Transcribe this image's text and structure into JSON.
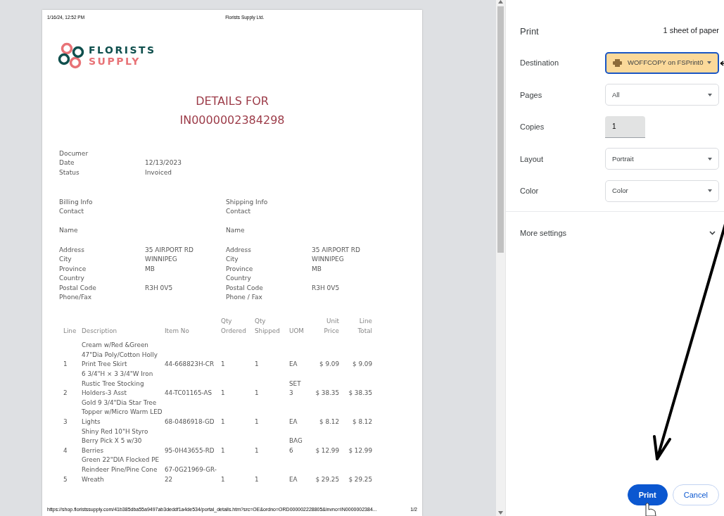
{
  "preview": {
    "header_left": "1/16/24, 12:52 PM",
    "header_center": "Florists Supply Ltd.",
    "logo": {
      "line1": "FLORISTS",
      "line2": "SUPPLY"
    },
    "title_lines": [
      "DETAILS FOR",
      "IN0000002384298"
    ],
    "doc_info": [
      {
        "label": "Documer"
      },
      {
        "label": "Date",
        "value": "12/13/2023"
      },
      {
        "label": "Status",
        "value": "Invoiced"
      }
    ],
    "addresses": [
      {
        "heading": "Billing Info",
        "groups": [
          [
            {
              "label": "Contact"
            }
          ],
          [
            {
              "label": "Name"
            }
          ],
          [
            {
              "label": "Address",
              "value": "35 AIRPORT RD"
            },
            {
              "label": "City",
              "value": "WINNIPEG"
            },
            {
              "label": "Province",
              "value": "MB"
            },
            {
              "label": "Country"
            },
            {
              "label": "Postal Code",
              "value": "R3H 0V5"
            },
            {
              "label": "Phone/Fax"
            }
          ]
        ]
      },
      {
        "heading": "Shipping Info",
        "groups": [
          [
            {
              "label": "Contact"
            }
          ],
          [
            {
              "label": "Name"
            }
          ],
          [
            {
              "label": "Address",
              "value": "35 AIRPORT RD"
            },
            {
              "label": "City",
              "value": "WINNIPEG"
            },
            {
              "label": "Province",
              "value": "MB"
            },
            {
              "label": "Country"
            },
            {
              "label": "Postal Code",
              "value": "R3H 0V5"
            },
            {
              "label": "Phone / Fax"
            }
          ]
        ]
      }
    ],
    "table": {
      "columns": [
        {
          "lines": [
            "Line"
          ]
        },
        {
          "lines": [
            "Description"
          ]
        },
        {
          "lines": [
            "Item No"
          ]
        },
        {
          "lines": [
            "Qty",
            "Ordered"
          ]
        },
        {
          "lines": [
            "Qty",
            "Shipped"
          ]
        },
        {
          "lines": [
            "UOM"
          ]
        },
        {
          "lines": [
            "Unit",
            "Price"
          ]
        },
        {
          "lines": [
            "Line",
            "Total"
          ]
        }
      ],
      "rows": [
        [
          "1",
          "Cream w/Red &Green 47\"Dia Poly/Cotton Holly Print Tree Skirt",
          "44-668823H-CR",
          "1",
          "1",
          "EA",
          "$ 9.09",
          "$ 9.09"
        ],
        [
          "2",
          "6 3/4\"H × 3 3/4\"W Iron Rustic Tree Stocking Holders-3 Asst",
          "44-TC01165-AS",
          "1",
          "1",
          "SET 3",
          "$ 38.35",
          "$ 38.35"
        ],
        [
          "3",
          "Gold 9 3/4\"Dia Star Tree Topper w/Micro Warm LED Lights",
          "68-0486918-GD",
          "1",
          "1",
          "EA",
          "$ 8.12",
          "$ 8.12"
        ],
        [
          "4",
          "Shiny Red 10\"H Styro Berry Pick X 5 w/30 Berries",
          "95-0H43655-RD",
          "1",
          "1",
          "BAG 6",
          "$ 12.99",
          "$ 12.99"
        ],
        [
          "5",
          "Green 22\"DIA Flocked PE Reindeer Pine/Pine Cone Wreath",
          "67-0G21969-GR-22",
          "1",
          "1",
          "EA",
          "$ 29.25",
          "$ 29.25"
        ]
      ]
    },
    "footer_url": "https://shop.floristssupply.com/41b385dba55a9497ab3deddf1a4de534/portal_details.htm?src=OE&ordno=ORD000002228805&invno=IN0000002384...",
    "footer_page": "1/2"
  },
  "print_panel": {
    "title": "Print",
    "sheets": "1 sheet of paper",
    "settings": [
      {
        "label": "Destination",
        "kind": "select",
        "value": "WOFFCOPY on FSPrint0",
        "printer_icon": true,
        "focused": true
      },
      {
        "label": "Pages",
        "kind": "select",
        "value": "All",
        "focused": false
      },
      {
        "label": "Copies",
        "kind": "number",
        "value": "1"
      },
      {
        "label": "Layout",
        "kind": "select",
        "value": "Portrait",
        "focused": false
      },
      {
        "label": "Color",
        "kind": "select",
        "value": "Color",
        "focused": false
      }
    ],
    "more_settings": "More settings",
    "buttons": [
      {
        "label": "Print",
        "primary": true
      },
      {
        "label": "Cancel",
        "primary": false
      }
    ]
  }
}
